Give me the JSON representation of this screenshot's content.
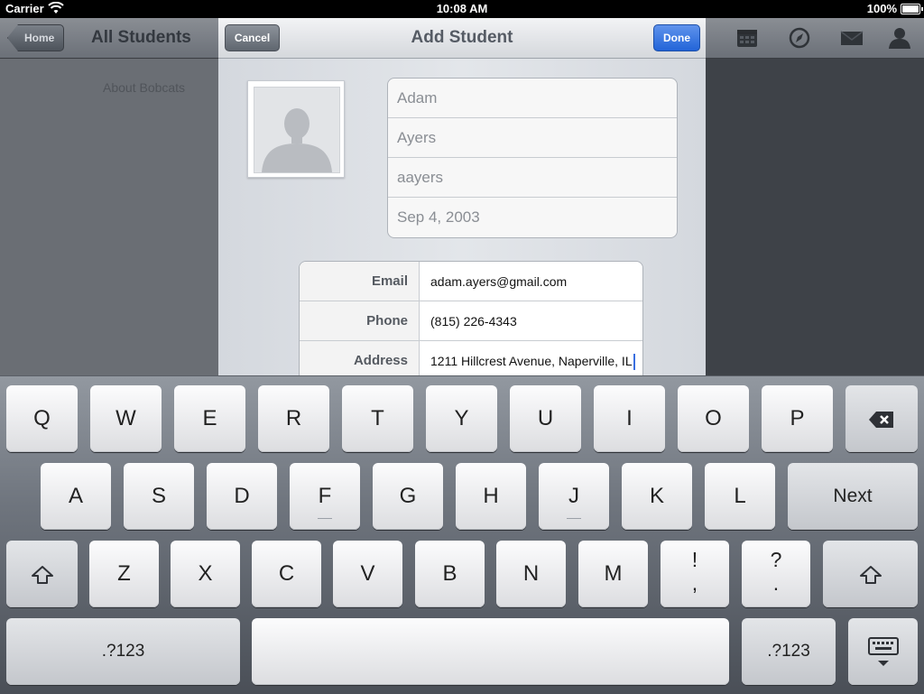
{
  "status_bar": {
    "carrier": "Carrier",
    "time": "10:08 AM",
    "battery": "100%"
  },
  "background_app": {
    "home_button": "Home",
    "title": "All Students",
    "about_link": "About Bobcats",
    "nav_icons": [
      "calendar-icon",
      "compass-icon",
      "mail-icon",
      "person-icon"
    ]
  },
  "modal": {
    "title": "Add Student",
    "cancel_label": "Cancel",
    "done_label": "Done",
    "name_fields": {
      "first_name": "Adam",
      "last_name": "Ayers",
      "username": "aayers",
      "birthdate": "Sep 4, 2003"
    },
    "info_fields": [
      {
        "label": "Email",
        "value": "adam.ayers@gmail.com"
      },
      {
        "label": "Phone",
        "value": "(815) 226-4343"
      },
      {
        "label": "Address",
        "value": "1211 Hillcrest Avenue, Naperville, IL"
      }
    ]
  },
  "keyboard": {
    "row1": [
      "Q",
      "W",
      "E",
      "R",
      "T",
      "Y",
      "U",
      "I",
      "O",
      "P"
    ],
    "row2": [
      "A",
      "S",
      "D",
      "F",
      "G",
      "H",
      "J",
      "K",
      "L"
    ],
    "row3": [
      "Z",
      "X",
      "C",
      "V",
      "B",
      "N",
      "M"
    ],
    "punct1": {
      "top": "!",
      "bottom": ","
    },
    "punct2": {
      "top": "?",
      "bottom": "."
    },
    "next_label": "Next",
    "numbers_label": ".?123",
    "icons": {
      "backspace": "backspace-icon",
      "shift": "shift-icon",
      "dismiss": "keyboard-dismiss-icon"
    }
  }
}
